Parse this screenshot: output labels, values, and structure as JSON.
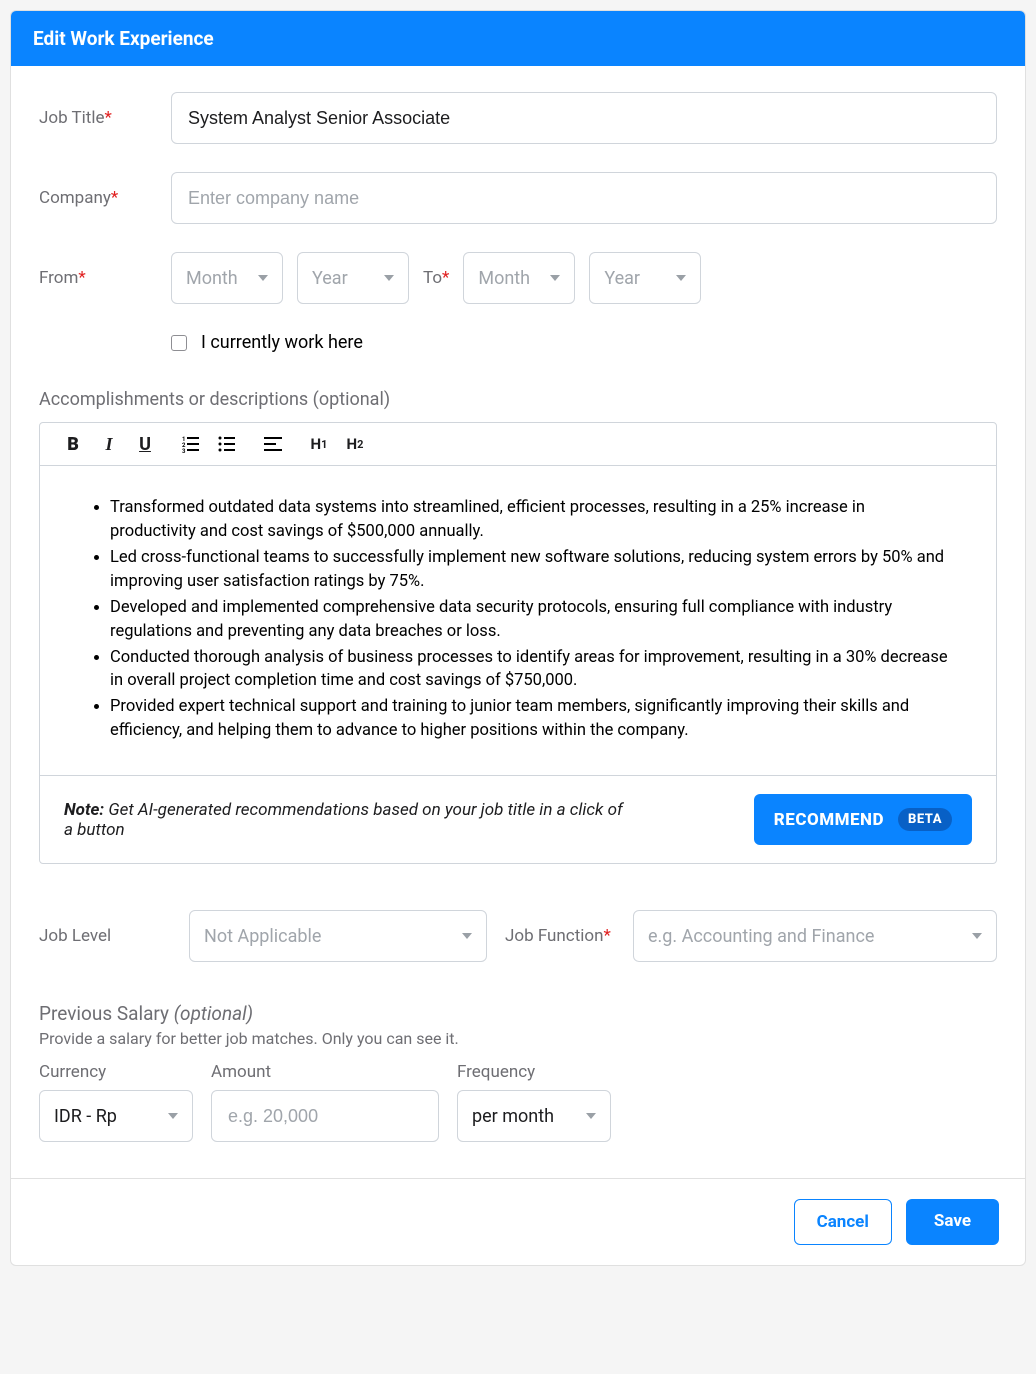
{
  "header": {
    "title": "Edit Work Experience"
  },
  "fields": {
    "job_title": {
      "label": "Job Title",
      "value": "System Analyst Senior Associate"
    },
    "company": {
      "label": "Company",
      "placeholder": "Enter company name"
    },
    "from_label": "From",
    "to_label": "To",
    "month_placeholder": "Month",
    "year_placeholder": "Year",
    "currently_work": "I currently work here"
  },
  "accomplishments": {
    "label": "Accomplishments or descriptions (optional)",
    "bullets": [
      "Transformed outdated data systems into streamlined, efficient processes, resulting in a 25% increase in productivity and cost savings of $500,000 annually.",
      "Led cross-functional teams to successfully implement new software solutions, reducing system errors by 50% and improving user satisfaction ratings by 75%.",
      "Developed and implemented comprehensive data security protocols, ensuring full compliance with industry regulations and preventing any data breaches or loss.",
      "Conducted thorough analysis of business processes to identify areas for improvement, resulting in a 30% decrease in overall project completion time and cost savings of $750,000.",
      "Provided expert technical support and training to junior team members, significantly improving their skills and efficiency, and helping them to advance to higher positions within the company."
    ],
    "note_prefix": "Note:",
    "note_text": " Get AI-generated recommendations based on your job title in a click of a button",
    "recommend_label": "RECOMMEND",
    "beta_label": "BETA"
  },
  "job_level": {
    "label": "Job Level",
    "value": "Not Applicable"
  },
  "job_function": {
    "label": "Job Function",
    "placeholder": "e.g. Accounting and Finance"
  },
  "salary": {
    "title": "Previous Salary ",
    "optional": "(optional)",
    "subtitle": "Provide a salary for better job matches. Only you can see it.",
    "currency_label": "Currency",
    "currency_value": "IDR - Rp",
    "amount_label": "Amount",
    "amount_placeholder": "e.g. 20,000",
    "frequency_label": "Frequency",
    "frequency_value": "per month"
  },
  "footer": {
    "cancel": "Cancel",
    "save": "Save"
  }
}
